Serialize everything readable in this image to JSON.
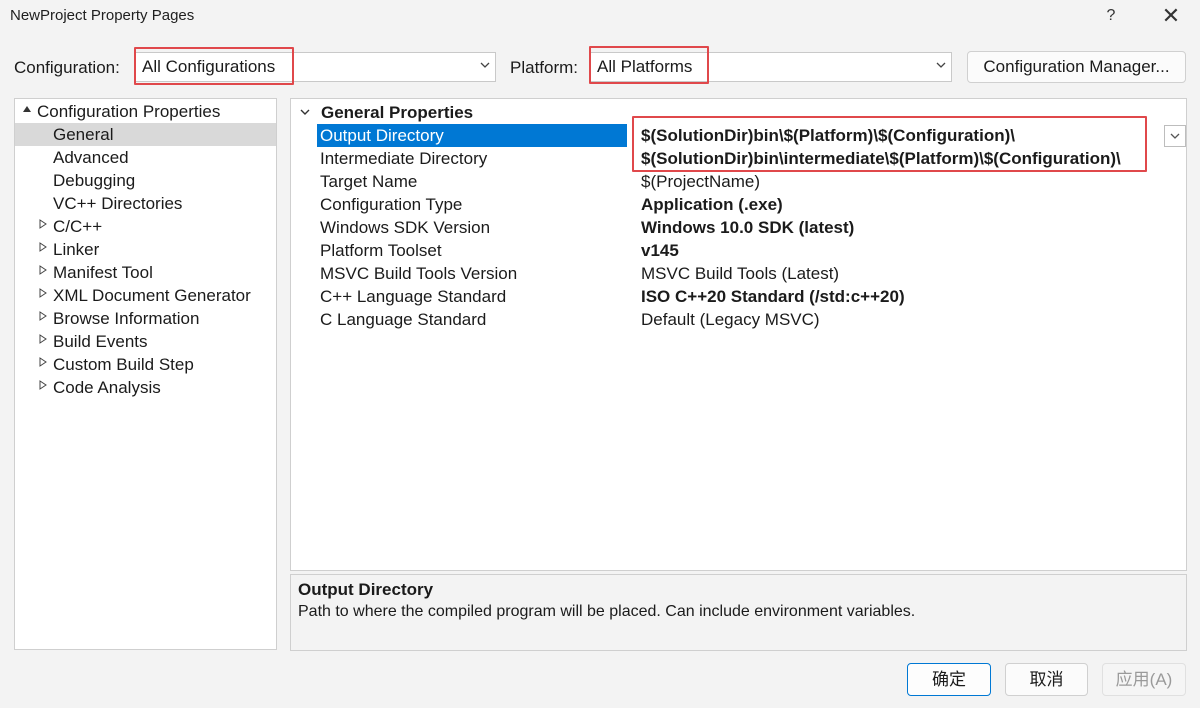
{
  "window": {
    "title": "NewProject Property Pages",
    "help_label": "?",
    "close_label": "✕"
  },
  "toolbar": {
    "configuration_label": "Configuration:",
    "configuration_value": "All Configurations",
    "platform_label": "Platform:",
    "platform_value": "All Platforms",
    "config_manager_label": "Configuration Manager..."
  },
  "tree": {
    "root": "Configuration Properties",
    "children": [
      "General",
      "Advanced",
      "Debugging",
      "VC++ Directories"
    ],
    "collapsed": [
      "C/C++",
      "Linker",
      "Manifest Tool",
      "XML Document Generator",
      "Browse Information",
      "Build Events",
      "Custom Build Step",
      "Code Analysis"
    ],
    "selected": "General"
  },
  "grid": {
    "section": "General Properties",
    "rows": [
      {
        "name": "Output Directory",
        "value": "$(SolutionDir)bin\\$(Platform)\\$(Configuration)\\"
      },
      {
        "name": "Intermediate Directory",
        "value": "$(SolutionDir)bin\\intermediate\\$(Platform)\\$(Configuration)\\"
      },
      {
        "name": "Target Name",
        "value": "$(ProjectName)"
      },
      {
        "name": "Configuration Type",
        "value": "Application (.exe)"
      },
      {
        "name": "Windows SDK Version",
        "value": "Windows 10.0 SDK (latest)"
      },
      {
        "name": "Platform Toolset",
        "value": "v145"
      },
      {
        "name": "MSVC Build Tools Version",
        "value": "MSVC Build Tools (Latest)"
      },
      {
        "name": "C++ Language Standard",
        "value": "ISO C++20 Standard (/std:c++20)"
      },
      {
        "name": "C Language Standard",
        "value": "Default (Legacy MSVC)"
      }
    ]
  },
  "description": {
    "title": "Output Directory",
    "text": "Path to where the compiled program will be placed. Can include environment variables."
  },
  "buttons": {
    "ok": "确定",
    "cancel": "取消",
    "apply": "应用(A)"
  },
  "colors": {
    "selection": "#0078d4",
    "highlight_box": "#e0484b",
    "tree_selected": "#d9d9d9"
  },
  "icons": {
    "expanded": "▲",
    "collapsed": "▷",
    "section_expanded": "∨",
    "dropdown": "∨"
  }
}
